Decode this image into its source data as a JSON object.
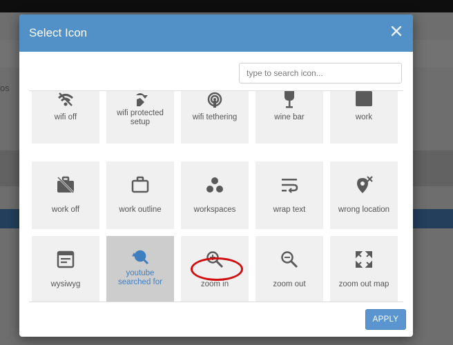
{
  "background": {
    "partial_text": "os"
  },
  "modal": {
    "title": "Select Icon",
    "search": {
      "placeholder": "type to search icon...",
      "value": ""
    },
    "apply_label": "APPLY"
  },
  "icons": [
    {
      "label": "wifi off",
      "icon": "wifi-off-icon"
    },
    {
      "label": "wifi protected\nsetup",
      "icon": "wifi-protected-setup-icon"
    },
    {
      "label": "wifi tethering",
      "icon": "wifi-tethering-icon"
    },
    {
      "label": "wine bar",
      "icon": "wine-bar-icon"
    },
    {
      "label": "work",
      "icon": "work-icon"
    },
    {
      "label": "work off",
      "icon": "work-off-icon"
    },
    {
      "label": "work outline",
      "icon": "work-outline-icon"
    },
    {
      "label": "workspaces",
      "icon": "workspaces-icon"
    },
    {
      "label": "wrap text",
      "icon": "wrap-text-icon"
    },
    {
      "label": "wrong location",
      "icon": "wrong-location-icon"
    },
    {
      "label": "wysiwyg",
      "icon": "wysiwyg-icon"
    },
    {
      "label": "youtube\nsearched for",
      "icon": "youtube-searched-for-icon",
      "selected": true
    },
    {
      "label": "zoom in",
      "icon": "zoom-in-icon",
      "annotated": true
    },
    {
      "label": "zoom out",
      "icon": "zoom-out-icon"
    },
    {
      "label": "zoom out map",
      "icon": "zoom-out-map-icon"
    }
  ],
  "colors": {
    "header": "#5290c8",
    "apply": "#5b95cf",
    "selected_tile": "#cdcdcd",
    "annotation": "#d10f10"
  }
}
